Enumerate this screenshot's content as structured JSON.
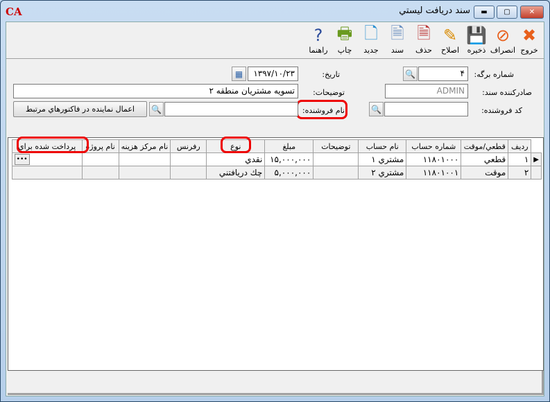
{
  "window": {
    "title": "سند دريافت ليستي",
    "logo": "CA",
    "controls": [
      "minimize",
      "maximize",
      "close"
    ]
  },
  "toolbar": [
    {
      "id": "exit",
      "label": "خروج",
      "icon": "close-x-icon",
      "color": "#e8601c"
    },
    {
      "id": "cancel",
      "label": "انصراف",
      "icon": "cancel-icon",
      "color": "#e8601c"
    },
    {
      "id": "save",
      "label": "ذخيره",
      "icon": "floppy-icon"
    },
    {
      "id": "edit",
      "label": "اصلاح",
      "icon": "pencil-icon"
    },
    {
      "id": "delete",
      "label": "حذف",
      "icon": "delete-doc-icon"
    },
    {
      "id": "document",
      "label": "سند",
      "icon": "document-icon"
    },
    {
      "id": "new",
      "label": "جديد",
      "icon": "new-doc-icon"
    },
    {
      "id": "print",
      "label": "چاپ",
      "icon": "printer-icon"
    },
    {
      "id": "help",
      "label": "راهنما",
      "icon": "question-icon"
    }
  ],
  "form": {
    "sheet_no_label": "شماره برگه:",
    "sheet_no": "۴",
    "date_label": "تاريخ:",
    "date": "۱۳۹۷/۱۰/۲۳",
    "issuer_label": "صادرکننده سند:",
    "issuer": "ADMIN",
    "desc_label": "توضيحات:",
    "desc": "تسويه مشتريان منطقه ۲",
    "seller_code_label": "کد فروشنده:",
    "seller_code": "",
    "seller_name_label": "نام فروشنده:",
    "seller_name": "",
    "apply_button": "اعمال نماينده در فاکتورهاي مرتبط"
  },
  "grid": {
    "columns": [
      "رديف",
      "قطعي/موقت",
      "شماره حساب",
      "نام حساب",
      "توضيحات",
      "مبلغ",
      "نوع",
      "رفرنس",
      "نام مرکز هزينه",
      "نام پروژه",
      "پرداخت شده براي"
    ],
    "rows": [
      [
        "۱",
        "قطعي",
        "۱۱۸۰۱۰۰۰",
        "مشتري ۱",
        "",
        "۱۵,۰۰۰,۰۰۰",
        "نقدي",
        "",
        "",
        "",
        ""
      ],
      [
        "۲",
        "موقت",
        "۱۱۸۰۱۰۰۱",
        "مشتري ۲",
        "",
        "۵,۰۰۰,۰۰۰",
        "چك دريافتني",
        "",
        "",
        "",
        ""
      ]
    ],
    "highlight_color": "#e00000"
  }
}
